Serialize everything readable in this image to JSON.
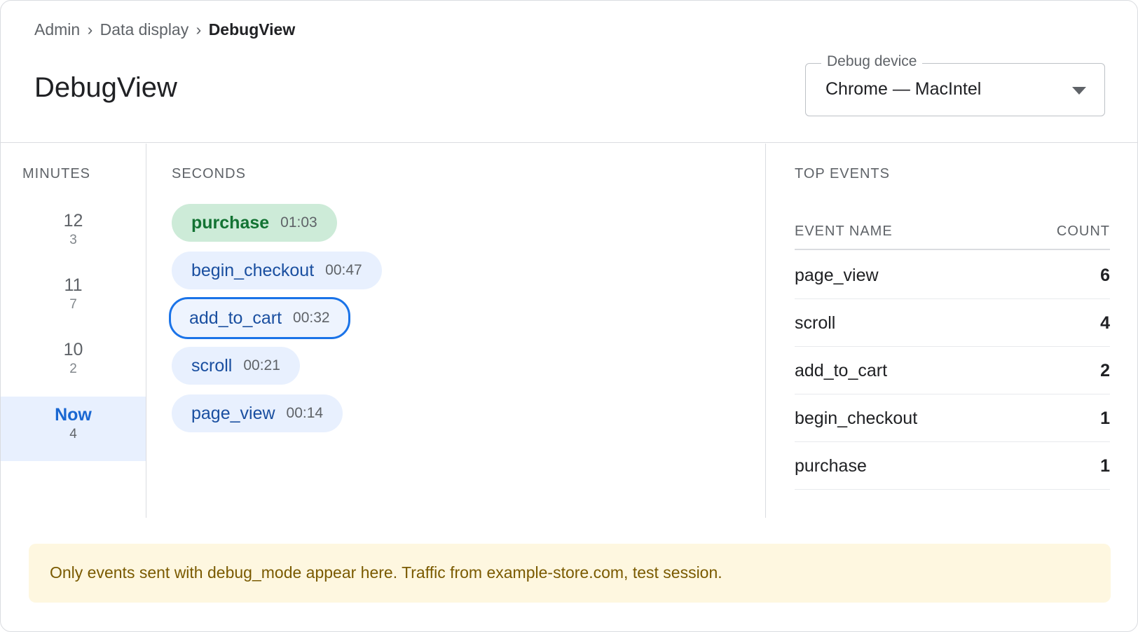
{
  "breadcrumb": {
    "items": [
      "Admin",
      "Data display"
    ],
    "separator": "›",
    "current": "DebugView"
  },
  "page": {
    "title": "DebugView"
  },
  "device_select": {
    "label": "Debug device",
    "value": "Chrome — MacIntel"
  },
  "minutes": {
    "header": "MINUTES",
    "items": [
      {
        "value": "12",
        "count": "3"
      },
      {
        "value": "11",
        "count": "7"
      },
      {
        "value": "10",
        "count": "2"
      },
      {
        "value": "Now",
        "count": "4",
        "active": true
      }
    ]
  },
  "seconds": {
    "header": "SECONDS",
    "events": [
      {
        "name": "purchase",
        "time": "01:03",
        "kind": "conversion"
      },
      {
        "name": "begin_checkout",
        "time": "00:47",
        "kind": "default"
      },
      {
        "name": "add_to_cart",
        "time": "00:32",
        "kind": "selected"
      },
      {
        "name": "scroll",
        "time": "00:21",
        "kind": "default"
      },
      {
        "name": "page_view",
        "time": "00:14",
        "kind": "default"
      }
    ]
  },
  "top_events": {
    "header": "TOP EVENTS",
    "col_name": "EVENT NAME",
    "col_count": "COUNT",
    "rows": [
      {
        "name": "page_view",
        "count": "6"
      },
      {
        "name": "scroll",
        "count": "4"
      },
      {
        "name": "add_to_cart",
        "count": "2"
      },
      {
        "name": "begin_checkout",
        "count": "1"
      },
      {
        "name": "purchase",
        "count": "1"
      }
    ]
  },
  "notice": {
    "text": "Only events sent with debug_mode appear here. Traffic from example-store.com, test session."
  },
  "colors": {
    "accent": "#1a73e8",
    "chip_default": "#e8f0fe",
    "chip_conversion": "#cdebd8",
    "notice_bg": "#fef7e0"
  }
}
